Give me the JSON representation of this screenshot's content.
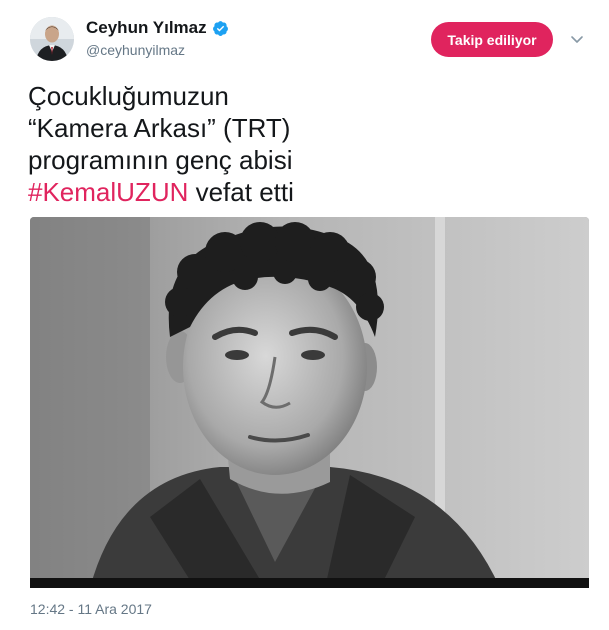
{
  "user": {
    "display_name": "Ceyhun Yılmaz",
    "handle": "@ceyhunyilmaz",
    "verified": true
  },
  "follow_button": {
    "label": "Takip ediliyor"
  },
  "tweet": {
    "lines": [
      "Çocukluğumuzun",
      "“Kamera Arkası” (TRT)",
      "programının genç abisi"
    ],
    "hashtag": "#KemalUZUN",
    "last_line_suffix": " vefat etti",
    "timestamp": "12:42 - 11 Ara 2017"
  },
  "colors": {
    "accent": "#e0245e",
    "verified": "#1da1f2",
    "secondary_text": "#657786",
    "primary_text": "#14171a"
  },
  "icons": {
    "verified": "verified-badge-icon",
    "chevron": "chevron-down-icon"
  }
}
